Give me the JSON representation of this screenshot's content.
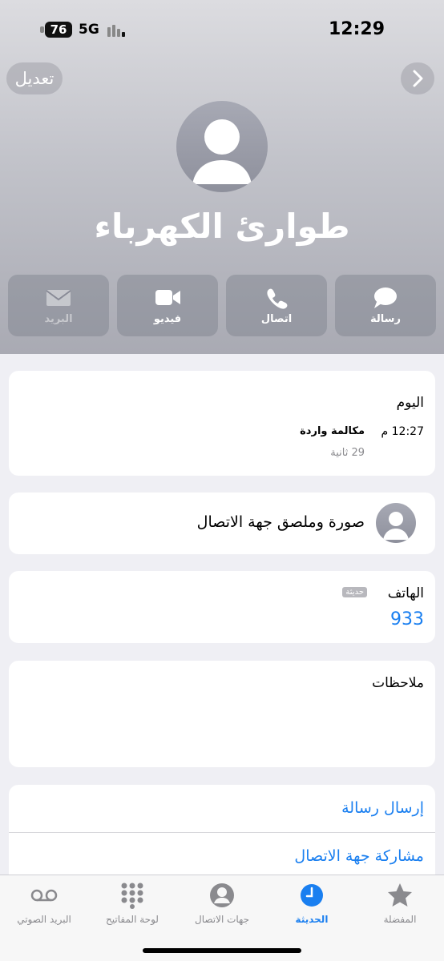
{
  "status_bar": {
    "time": "12:29",
    "battery": "76",
    "network": "5G"
  },
  "header": {
    "edit_label": "تعديل",
    "contact_name": "طوارئ الكهرباء",
    "actions": [
      {
        "label": "رسالة",
        "icon": "message-bubble-icon"
      },
      {
        "label": "اتصال",
        "icon": "phone-icon"
      },
      {
        "label": "فيديو",
        "icon": "video-camera-icon"
      },
      {
        "label": "البريد",
        "icon": "mail-icon",
        "disabled": true
      }
    ]
  },
  "call_log": {
    "day": "اليوم",
    "time": "12:27 م",
    "type": "مكالمة واردة",
    "duration": "29 ثانية"
  },
  "contact_photo": {
    "label": "صورة وملصق جهة الاتصال"
  },
  "phone": {
    "label": "الهاتف",
    "badge": "حديثة",
    "number": "933"
  },
  "notes": {
    "label": "ملاحظات"
  },
  "options": [
    {
      "label": "إرسال رسالة"
    },
    {
      "label": "مشاركة جهة الاتصال"
    }
  ],
  "tabbar": {
    "items": [
      {
        "label": "المفضلة",
        "icon": "star-icon"
      },
      {
        "label": "الحديثة",
        "icon": "clock-icon",
        "active": true
      },
      {
        "label": "جهات الاتصال",
        "icon": "person-circle-icon"
      },
      {
        "label": "لوحة المفاتيح",
        "icon": "keypad-icon"
      },
      {
        "label": "البريد الصوتي",
        "icon": "voicemail-icon"
      }
    ]
  },
  "colors": {
    "accent": "#1a7ff0",
    "header_gradient_top": "#dcdce0",
    "header_gradient_bottom": "#a9aab3"
  }
}
